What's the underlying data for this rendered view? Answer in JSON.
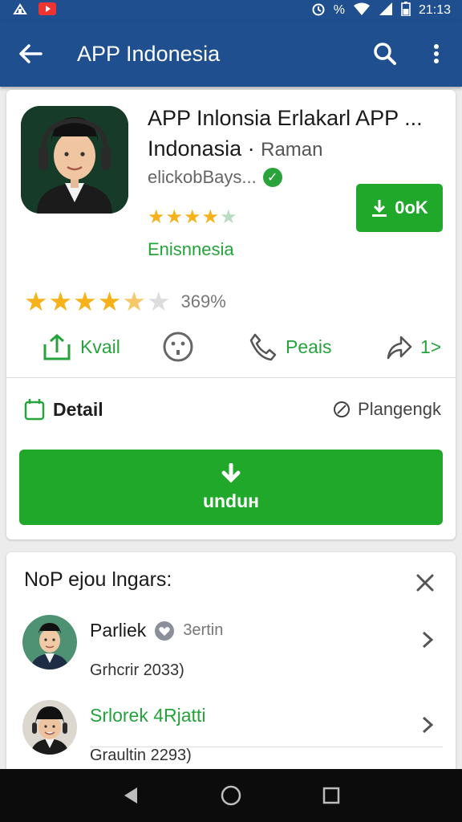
{
  "status": {
    "time": "21:13",
    "battery_pct": "%"
  },
  "app_bar": {
    "title": "APP Indonesia"
  },
  "app": {
    "name_line1": "APP Inlonsia Erlakarl APP ...",
    "name_line2": "Indonasia",
    "name_suffix": "Raman",
    "developer": "elickobBays...",
    "category": "Enisnnesia",
    "small_rating": 4.5,
    "install_label": "0oK",
    "rating_pct": "369%",
    "rating": 4.5
  },
  "actions": [
    {
      "label": "Kvail",
      "icon": "share-up-icon"
    },
    {
      "label": "",
      "icon": "emoji-icon"
    },
    {
      "label": "Peais",
      "icon": "phone-icon"
    },
    {
      "label": "1>",
      "icon": "forward-icon"
    }
  ],
  "detail": {
    "left_label": "Detail",
    "right_label": "Plangengk"
  },
  "download": {
    "label": "unduн"
  },
  "list": {
    "title": "NoP ejou lngars:",
    "items": [
      {
        "name": "Parliek",
        "tag": "3ertin",
        "sub": "Grhcrir 2033)",
        "name_color": "#1a1a1a"
      },
      {
        "name": "Srlorek 4Rjatti",
        "tag": "",
        "sub": "Graultin 2293)",
        "name_color": "#24a33a"
      }
    ]
  },
  "colors": {
    "primary": "#1f4f8e",
    "accent_green": "#1fa82a",
    "star": "#f5b21b"
  }
}
